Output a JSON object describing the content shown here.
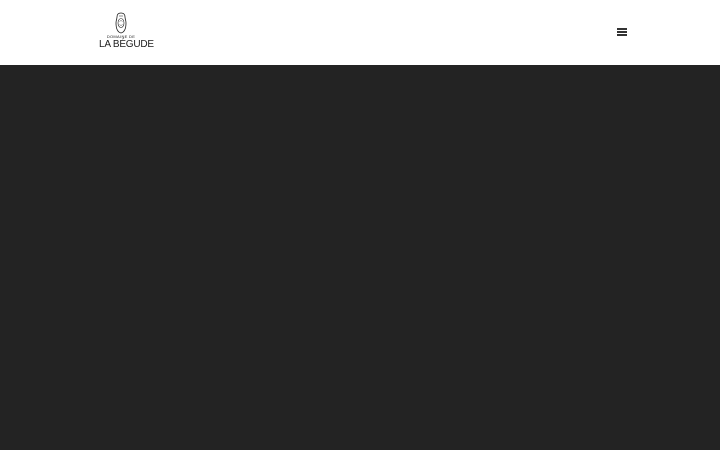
{
  "header": {
    "logo": {
      "line1": "DOMAINE DE",
      "line2": "LA BÉGUDE",
      "emblem_icon": "bottle-seal-icon"
    },
    "menu_icon": "hamburger-menu-icon"
  },
  "colors": {
    "header_bg": "#ffffff",
    "main_bg": "#232323",
    "logo_text": "#1c1c1c",
    "menu_icon": "#333333"
  }
}
